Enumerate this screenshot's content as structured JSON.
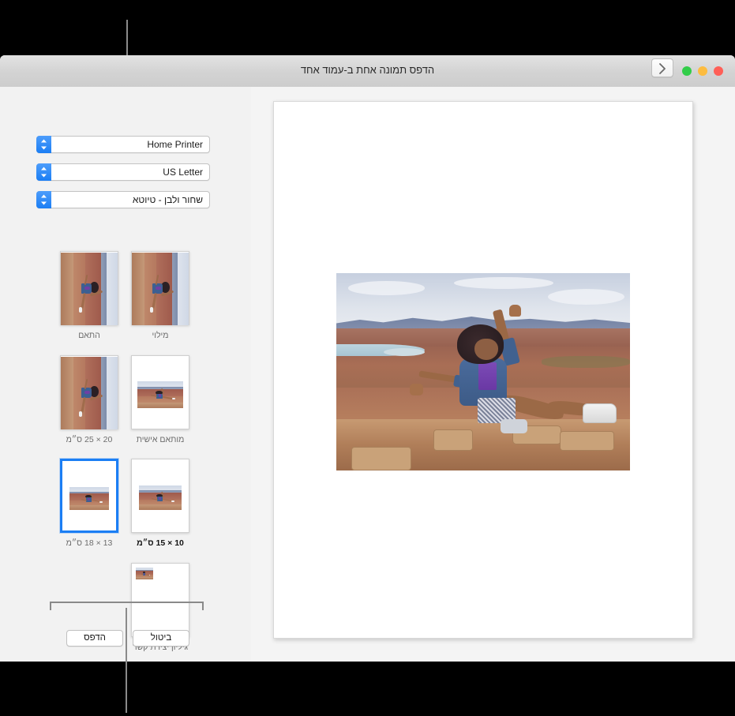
{
  "window": {
    "title": "הדפס תמונה אחת ב-עמוד אחד",
    "traffic_lights": [
      "green",
      "amber",
      "red"
    ],
    "collapse_button_icon": "chevron-right-icon"
  },
  "sidebar": {
    "popups": [
      {
        "name": "printer",
        "value": "Home Printer"
      },
      {
        "name": "paper-size",
        "value": "US Letter"
      },
      {
        "name": "print-style",
        "value": "שחור ולבן - טיוטא"
      }
    ],
    "presets": [
      {
        "label": "מילוי",
        "selected": false,
        "orientation": "portrait-rotated",
        "fill": "full"
      },
      {
        "label": "התאם",
        "selected": false,
        "orientation": "portrait-rotated",
        "fill": "full"
      },
      {
        "label": "מותאם אישית",
        "selected": false,
        "orientation": "portrait-rotated",
        "fill": "full"
      },
      {
        "label": "20 × 25 ס״מ",
        "selected": false,
        "orientation": "portrait",
        "fill": "medium"
      },
      {
        "label": "13 × 18 ס״מ",
        "selected": true,
        "orientation": "portrait",
        "fill": "small"
      },
      {
        "label": "10 × 15 ס״מ",
        "selected": false,
        "orientation": "portrait",
        "fill": "small"
      },
      {
        "label": "גיליון יצירת קשר",
        "selected": false,
        "orientation": "portrait",
        "fill": "tiny"
      }
    ],
    "buttons": {
      "print": "הדפס",
      "cancel": "ביטול"
    }
  },
  "preview": {
    "page_label": "print-preview-page",
    "photo_description": "woman-on-canyon-overlook-photo"
  },
  "colors": {
    "accent": "#1b7ef4",
    "window_bg": "#f2f2f2",
    "titlebar_top": "#e2e2e2",
    "titlebar_bottom": "#cdcdcd",
    "traffic_green": "#32cd49",
    "traffic_amber": "#fdbc40",
    "traffic_red": "#ff5f57",
    "callout_line": "#8a8a8a",
    "caption": "#6d6d6d"
  }
}
